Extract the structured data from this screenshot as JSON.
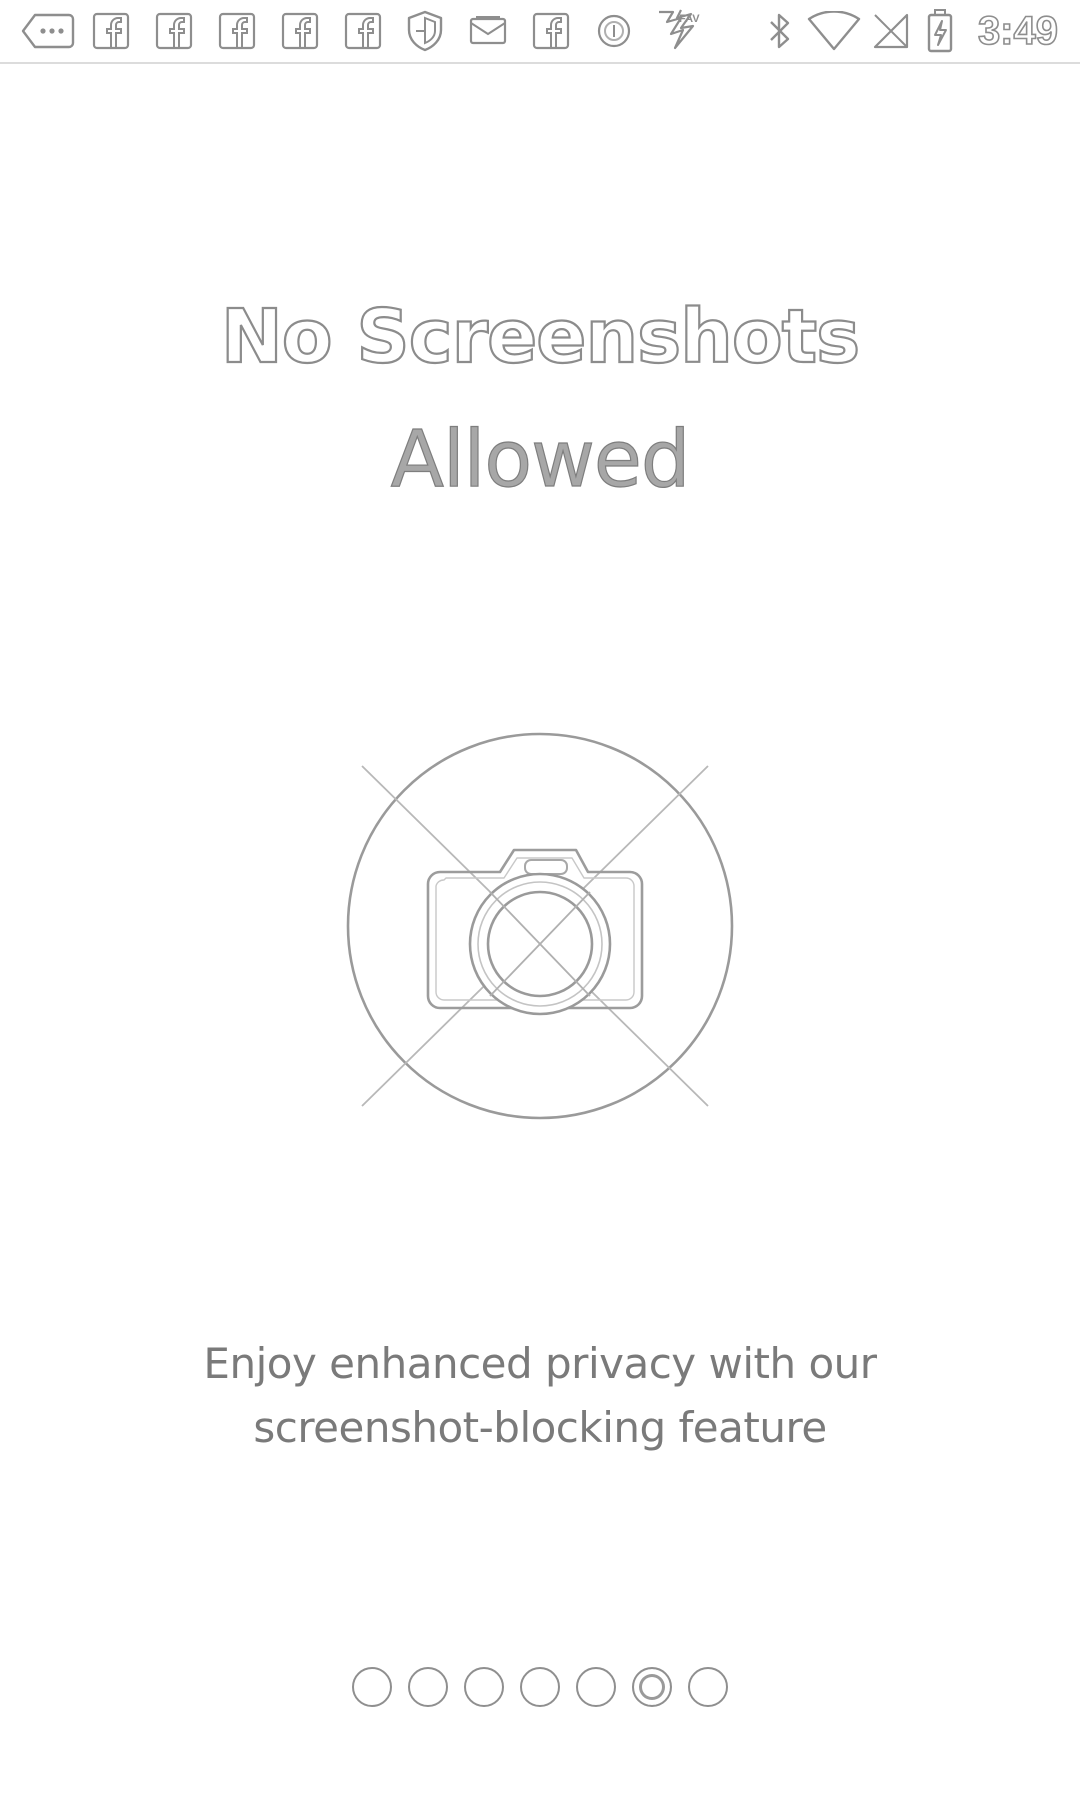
{
  "status_bar": {
    "time": "3:49",
    "left_icons": [
      "more-options-icon",
      "facebook-icon",
      "facebook-icon",
      "facebook-icon",
      "facebook-icon",
      "facebook-icon",
      "shield-icon",
      "email-icon",
      "facebook-icon",
      "circle-icon",
      "app-icon"
    ],
    "right_icons": [
      "bluetooth-icon",
      "wifi-icon",
      "no-sim-icon",
      "battery-charging-icon"
    ]
  },
  "onboarding": {
    "title_line1": "No Screenshots",
    "title_line2": "Allowed",
    "illustration": "no-camera-icon",
    "description": "Enjoy enhanced privacy with our screenshot-blocking feature",
    "pages_total": 7,
    "current_page": 6
  },
  "colors": {
    "background": "#ffffff",
    "outline_gray": "#8c8c8c",
    "text_gray": "#7a7a7a"
  }
}
